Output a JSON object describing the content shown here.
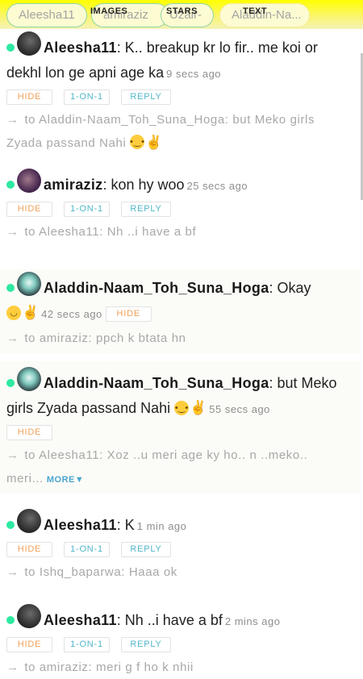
{
  "tabs": [
    "Aleesha11",
    "amiraziz",
    "Uzair-",
    "Aladdin-Na..."
  ],
  "overlay_labels": {
    "images": "IMAGES",
    "stars": "STARS",
    "text": "TEXT"
  },
  "buttons": {
    "hide": "HIDE",
    "one_on_one": "1-ON-1",
    "reply": "REPLY",
    "more": "MORE▼"
  },
  "reply_prefix": "→",
  "messages": [
    {
      "user": "Aleesha11",
      "text": ": K.. breakup kr lo fir.. me koi or dekhl lon ge apni age ka",
      "time": "9 secs ago",
      "reply": "to Aladdin-Naam_Toh_Suna_Hoga: but Meko girls Zyada passand Nahi"
    },
    {
      "user": "amiraziz",
      "text": ": kon hy woo",
      "time": "25 secs ago",
      "reply": "to Aleesha11: Nh ..i have a bf"
    },
    {
      "user": "Aladdin-Naam_Toh_Suna_Hoga",
      "text": ": Okay",
      "time": "42 secs ago",
      "reply": "to amiraziz: ppch k btata hn"
    },
    {
      "user": "Aladdin-Naam_Toh_Suna_Hoga",
      "text": ": but Meko girls Zyada passand Nahi",
      "time": "55 secs ago",
      "reply": "to Aleesha11: Xoz ..u meri age ky ho.. n ..meko.. meri..."
    },
    {
      "user": "Aleesha11",
      "text": ": K",
      "time": "1 min ago",
      "reply": "to Ishq_baparwa: Haaa ok"
    },
    {
      "user": "Aleesha11",
      "text": ": Nh ..i have a bf",
      "time": "2 mins ago",
      "reply": "to amiraziz: meri g f ho k nhii"
    }
  ]
}
